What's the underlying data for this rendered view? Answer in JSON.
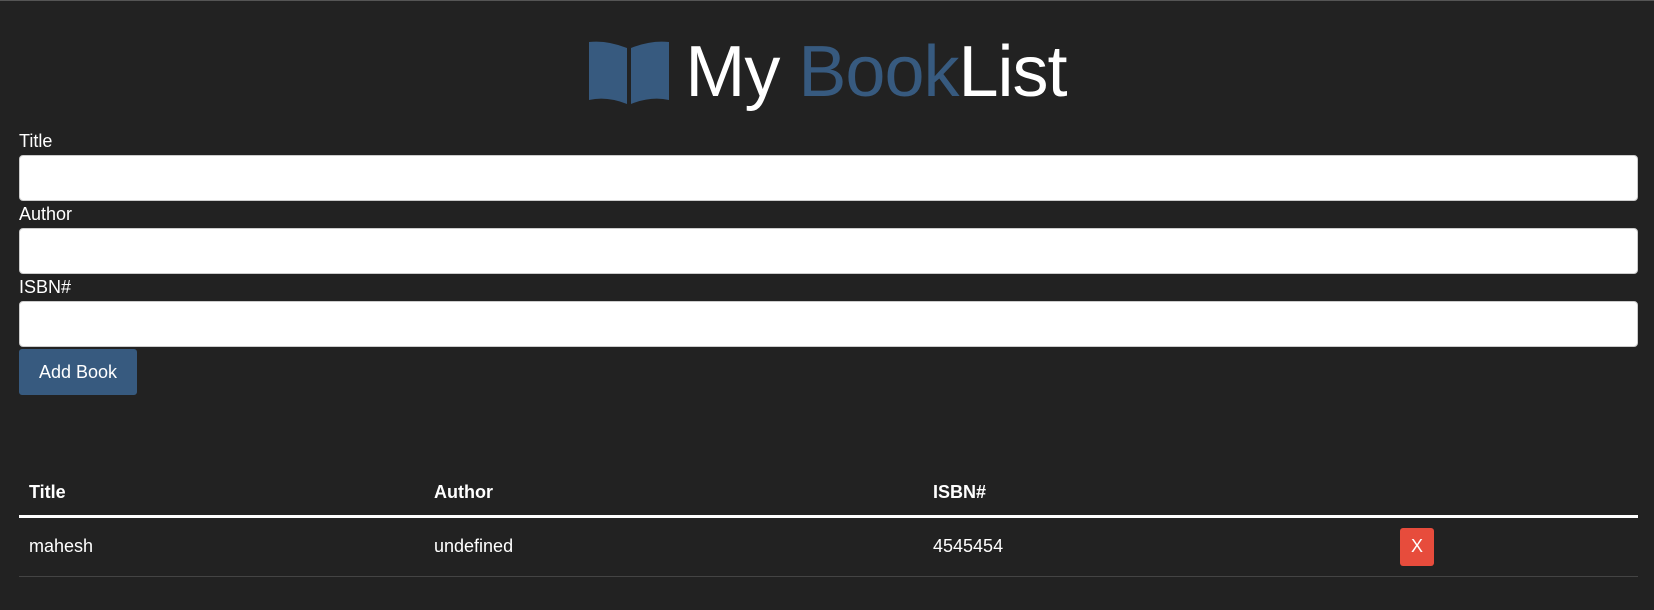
{
  "header": {
    "brand_my": "My ",
    "brand_book": "Book",
    "brand_list": "List",
    "logo_icon": "book-open-icon",
    "accent_color": "#375a7f"
  },
  "form": {
    "title_label": "Title",
    "title_value": "",
    "author_label": "Author",
    "author_value": "",
    "isbn_label": "ISBN#",
    "isbn_value": "",
    "submit_label": "Add Book"
  },
  "table": {
    "headers": [
      "Title",
      "Author",
      "ISBN#",
      ""
    ],
    "rows": [
      {
        "title": "mahesh",
        "author": "undefined",
        "isbn": "4545454",
        "delete_label": "X"
      }
    ]
  },
  "colors": {
    "background": "#222222",
    "delete_button": "#e74c3c"
  }
}
